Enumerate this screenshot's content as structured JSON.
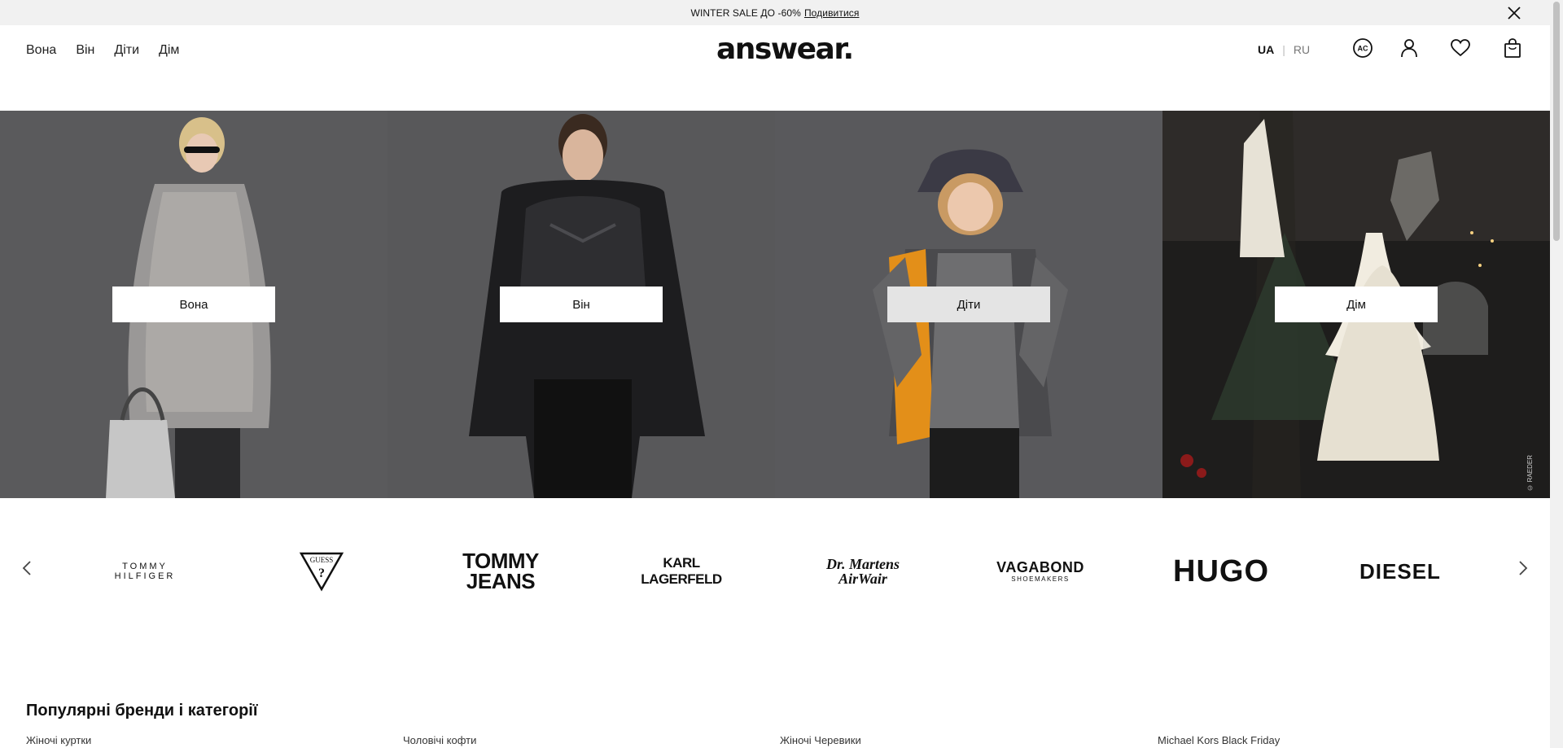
{
  "promo": {
    "text": "WINTER SALE ДО -60%",
    "link": "Подивитися"
  },
  "header": {
    "nav": [
      "Вона",
      "Він",
      "Діти",
      "Дім"
    ],
    "logo": "answear.",
    "lang_ua": "UA",
    "lang_sep": "|",
    "lang_ru": "RU",
    "icons": [
      "accessibility-icon",
      "user-icon",
      "heart-icon",
      "bag-icon"
    ],
    "accessibility_label": "AC"
  },
  "hero": {
    "tiles": [
      "Вона",
      "Він",
      "Діти",
      "Дім"
    ],
    "credit": "© RAEDER"
  },
  "brands": {
    "items": [
      "TOMMY HILFIGER",
      "GUESS",
      "TOMMY JEANS",
      "KARL LAGERFELD",
      "Dr. Martens AirWair",
      "VAGABOND",
      "HUGO",
      "DIESEL"
    ],
    "vagabond_sub": "SHOEMAKERS"
  },
  "popular": {
    "title": "Популярні бренди і категорії",
    "links": [
      "Жіночі куртки",
      "Чоловічі кофти",
      "Жіночі Черевики",
      "Michael Kors Black Friday"
    ]
  }
}
